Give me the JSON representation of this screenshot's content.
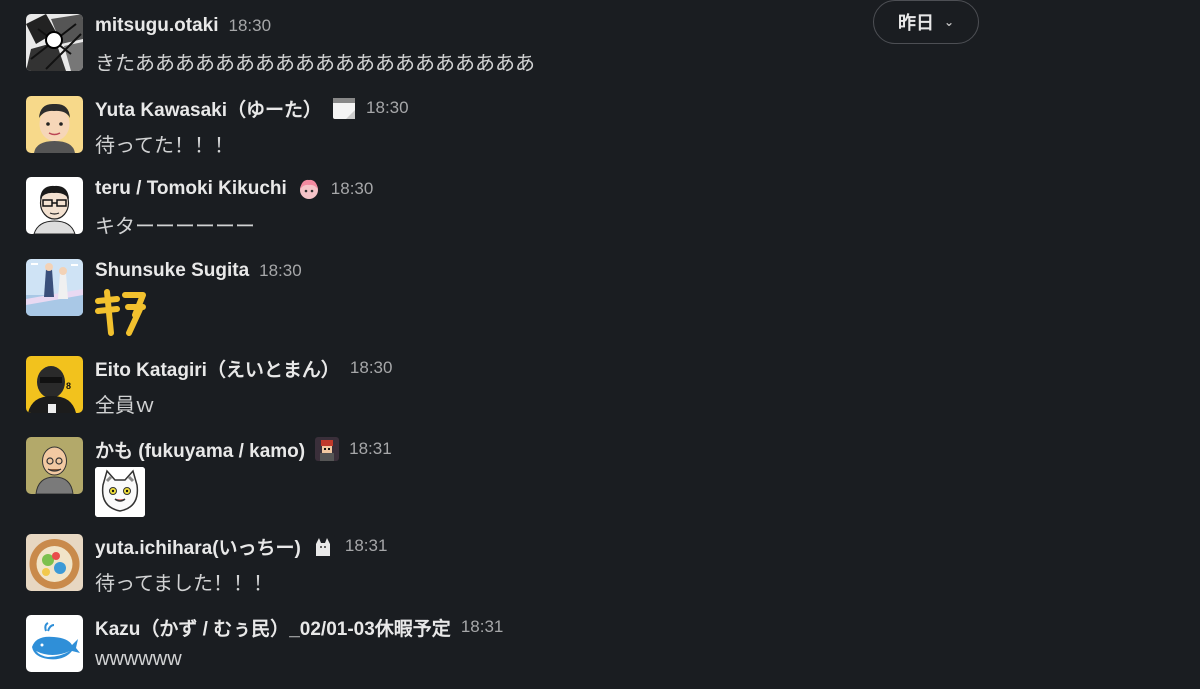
{
  "date_divider": {
    "label": "昨日",
    "chevron": "chevron-down-icon"
  },
  "messages": [
    {
      "name": "mitsugu.otaki",
      "time": "18:30",
      "text": "きたああああああああああああああああああああ",
      "status_icon": "",
      "avatar": "manga-avatar"
    },
    {
      "name": "Yuta Kawasaki（ゆーた）",
      "time": "18:30",
      "text": "待ってた！！！",
      "status_icon": "calendar-icon",
      "avatar": "cartoon-man-avatar"
    },
    {
      "name": "teru / Tomoki Kikuchi",
      "time": "18:30",
      "text": "キターーーーーー",
      "status_icon": "anime-girl-icon",
      "avatar": "glasses-man-avatar"
    },
    {
      "name": "Shunsuke Sugita",
      "time": "18:30",
      "text": "",
      "big_emoji": "kita-emoji",
      "status_icon": "",
      "avatar": "illustration-avatar"
    },
    {
      "name": "Eito Katagiri（えいとまん）",
      "time": "18:30",
      "text": "全員ｗ",
      "status_icon": "",
      "avatar": "yellow-avatar"
    },
    {
      "name": "かも (fukuyama / kamo)",
      "time": "18:31",
      "text": "",
      "sticker": "cat-sticker",
      "status_icon": "pixel-character-icon",
      "avatar": "bald-man-avatar"
    },
    {
      "name": "yuta.ichihara(いっちー)",
      "time": "18:31",
      "text": "待ってました！！！",
      "status_icon": "cat-icon",
      "avatar": "food-avatar"
    },
    {
      "name": "Kazu（かず / むぅ民）_02/01-03休暇予定",
      "time": "18:31",
      "text": "wwwwww",
      "status_icon": "",
      "avatar": "whale-avatar"
    }
  ],
  "colors": {
    "background": "#1a1d21",
    "text": "#d1d2d3",
    "name": "#e8e8e8",
    "time": "#a6a7a9",
    "kita": "#f2c12e"
  }
}
